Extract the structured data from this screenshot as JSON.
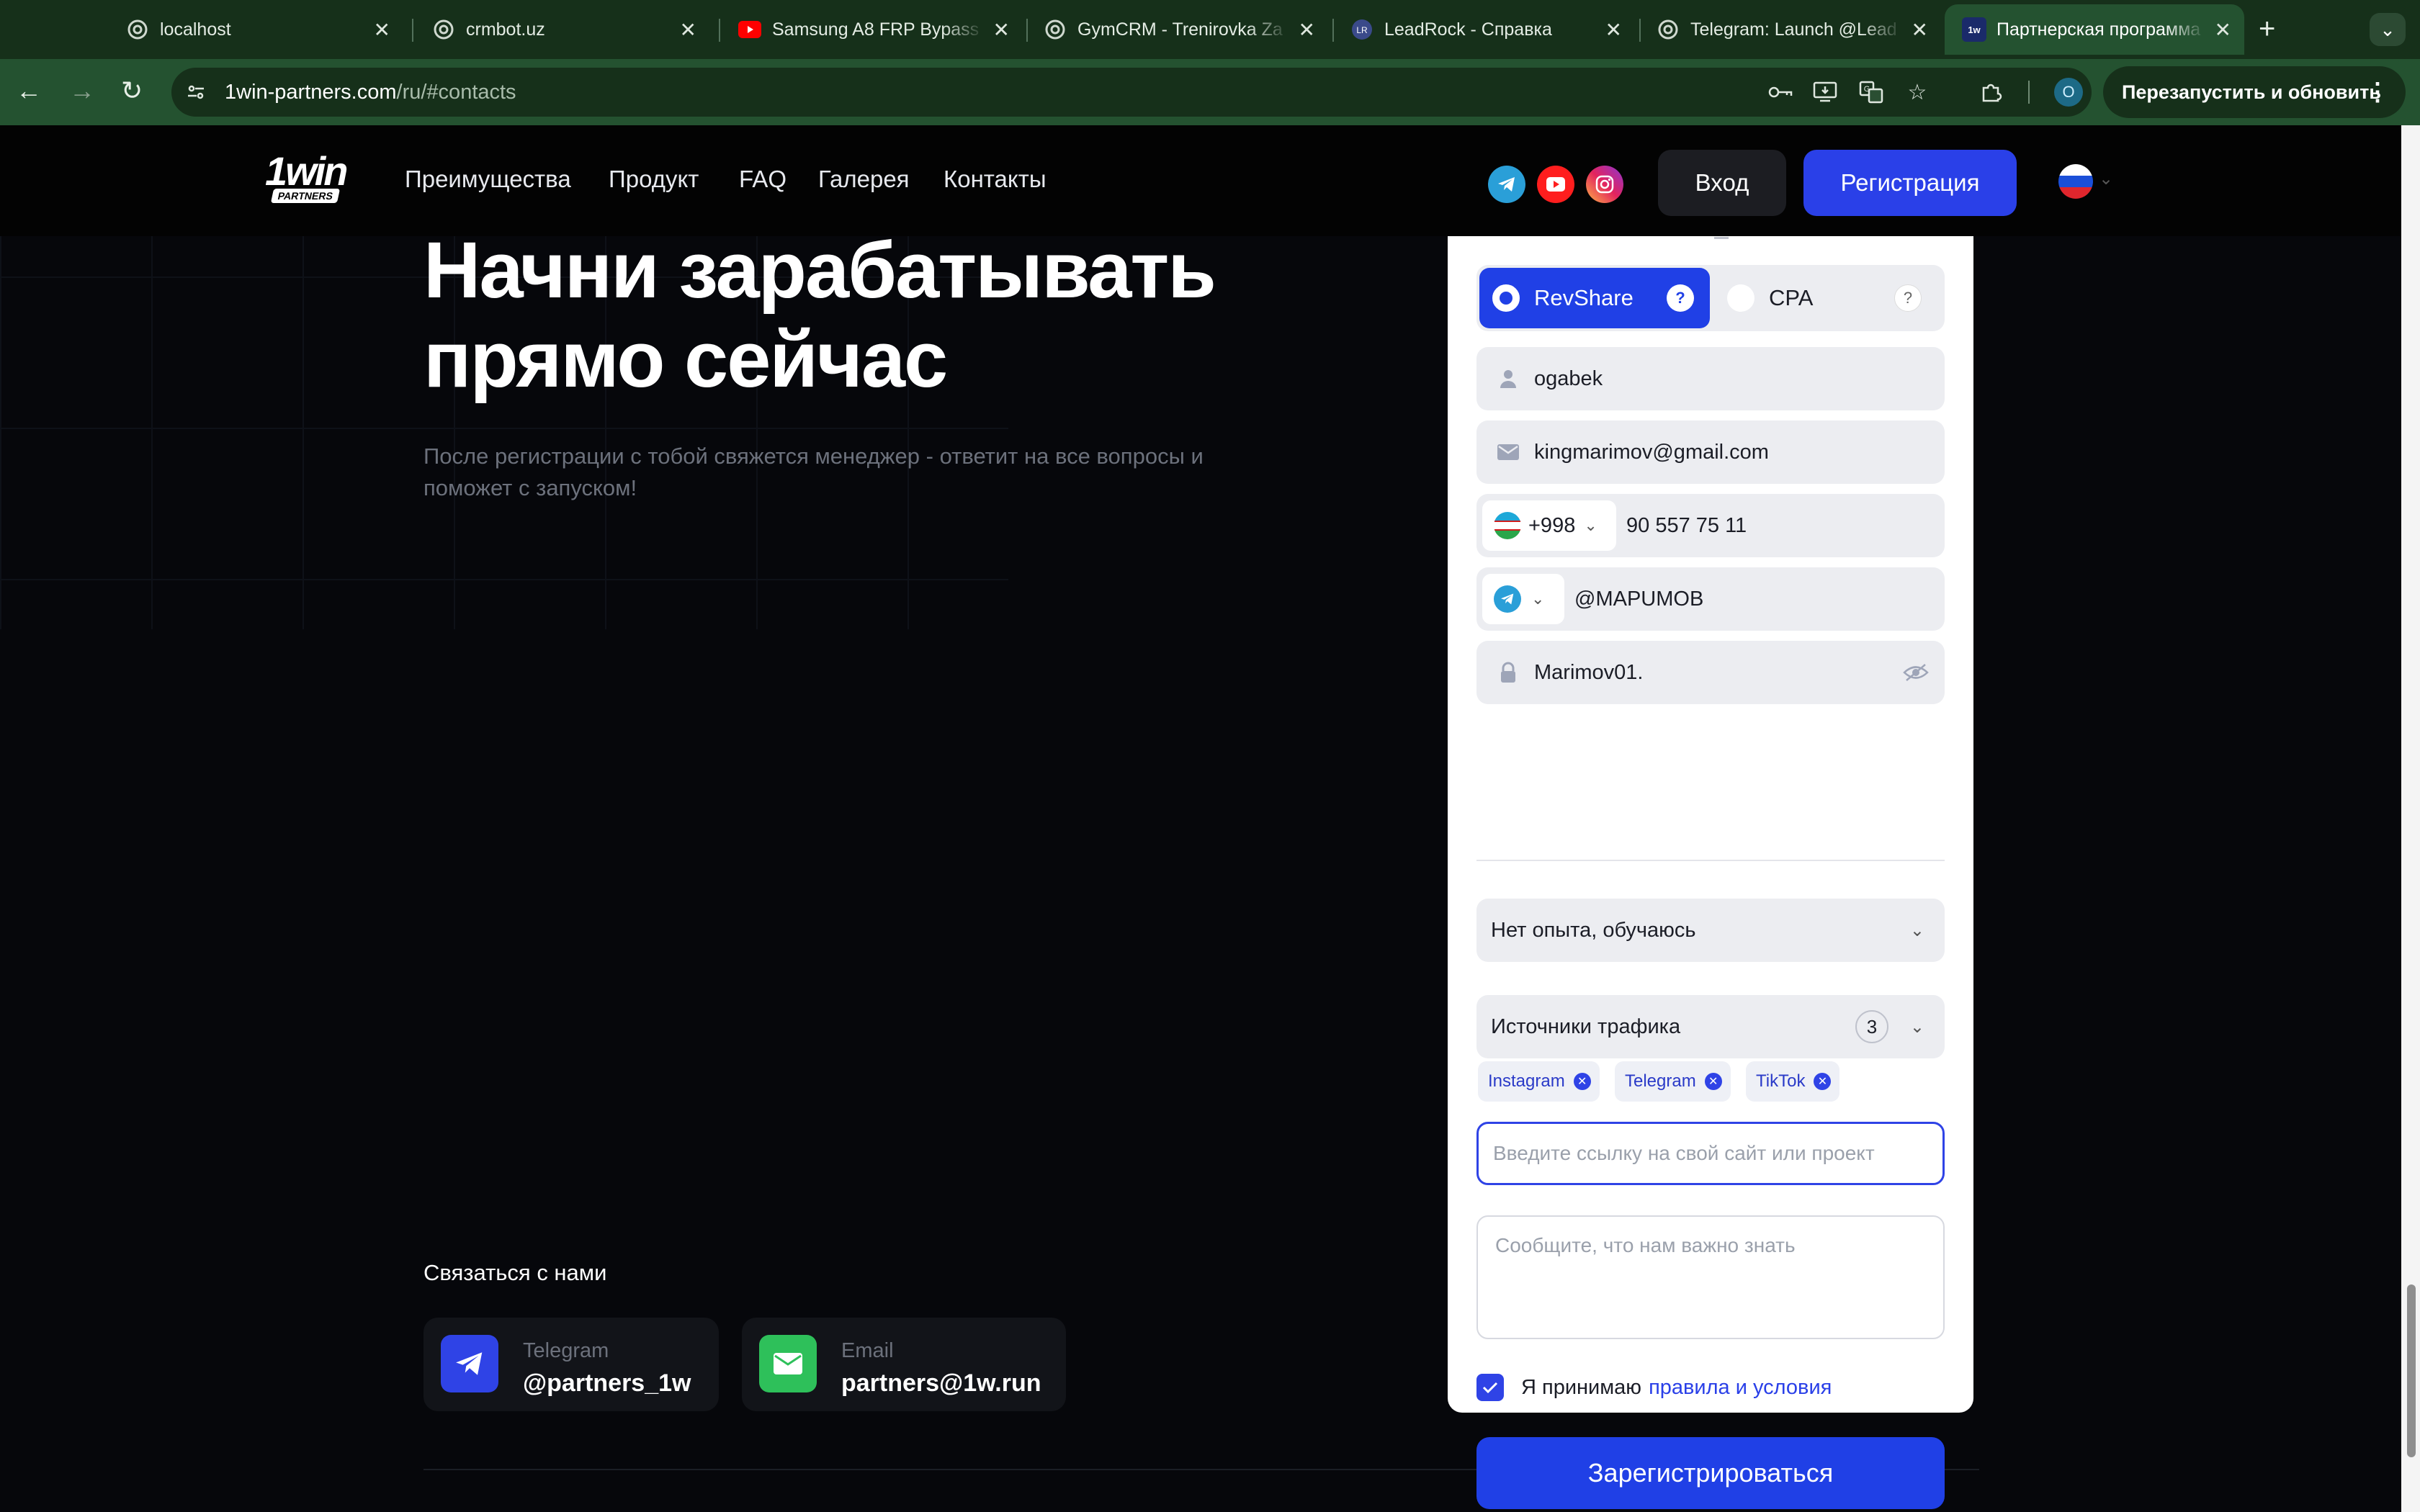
{
  "browser": {
    "tabs": [
      {
        "title": "localhost"
      },
      {
        "title": "crmbot.uz"
      },
      {
        "title": "Samsung A8 FRP Bypass"
      },
      {
        "title": "GymCRM - Trenirovka Za"
      },
      {
        "title": "LeadRock - Справка"
      },
      {
        "title": "Telegram: Launch @Lead"
      },
      {
        "title": "Партнерская программа"
      }
    ],
    "url_host": "1win-partners.com",
    "url_path": "/ru/#contacts",
    "profile_initial": "O",
    "restart_label": "Перезапустить и обновить"
  },
  "site": {
    "logo_text": "1win",
    "logo_sub": "PARTNERS",
    "nav": [
      "Преимущества",
      "Продукт",
      "FAQ",
      "Галерея",
      "Контакты"
    ],
    "login_label": "Вход",
    "register_label": "Регистрация"
  },
  "hero": {
    "title_line1": "Начни зарабатывать",
    "title_line2": "прямо сейчас",
    "subtitle": "После регистрации с тобой свяжется менеджер - ответит на все вопросы и поможет с запуском!"
  },
  "contacts": {
    "heading": "Связаться с нами",
    "telegram_label": "Telegram",
    "telegram_value": "@partners_1w",
    "email_label": "Email",
    "email_value": "partners@1w.run"
  },
  "form": {
    "model_revshare": "RevShare",
    "model_cpa": "CPA",
    "model_help": "?",
    "name": "ogabek",
    "email": "kingmarimov@gmail.com",
    "phone_code": "+998",
    "phone_number": "90 557 75 11",
    "messenger_value": "@MAPUMOB",
    "password": "Marimov01.",
    "experience": "Нет опыта, обучаюсь",
    "traffic_label": "Источники трафика",
    "traffic_count": "3",
    "chips": [
      "Instagram",
      "Telegram",
      "TikTok"
    ],
    "link_placeholder": "Введите ссылку на свой сайт или проект",
    "note_placeholder": "Сообщите, что нам важно знать",
    "agree_text": "Я принимаю",
    "agree_link": "правила и условия",
    "submit_label": "Зарегистрироваться"
  },
  "colors": {
    "accent": "#2040e6",
    "browser_frame": "#245230",
    "page_bg": "#06070b"
  }
}
